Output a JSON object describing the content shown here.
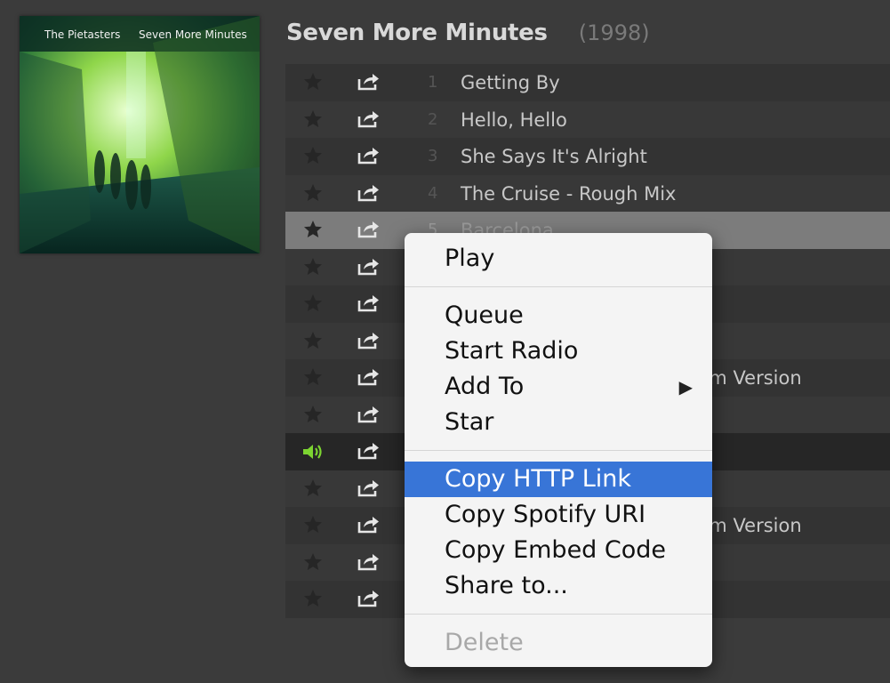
{
  "album": {
    "artist_cover_label": "The Pietasters",
    "cover_title_label": "Seven More Minutes",
    "title": "Seven More Minutes",
    "year": "(1998)"
  },
  "tracks": [
    {
      "num": "1",
      "name": "Getting By"
    },
    {
      "num": "2",
      "name": "Hello, Hello"
    },
    {
      "num": "3",
      "name": "She Says It's Alright"
    },
    {
      "num": "4",
      "name": "The Cruise - Rough Mix"
    },
    {
      "num": "5",
      "name": "Barcelona"
    },
    {
      "num": "",
      "name": ""
    },
    {
      "num": "",
      "name": ""
    },
    {
      "num": "",
      "name": ""
    },
    {
      "num": "",
      "name": "",
      "tail": "um Version"
    },
    {
      "num": "",
      "name": ""
    },
    {
      "num": "",
      "name": "",
      "playing": true
    },
    {
      "num": "",
      "name": ""
    },
    {
      "num": "",
      "name": "",
      "tail": "um Version"
    },
    {
      "num": "",
      "name": ""
    },
    {
      "num": "",
      "name": ""
    }
  ],
  "context_menu": {
    "play": "Play",
    "queue": "Queue",
    "start_radio": "Start Radio",
    "add_to": "Add To",
    "add_to_arrow": "▶",
    "star": "Star",
    "copy_http_link": "Copy HTTP Link",
    "copy_spotify_uri": "Copy Spotify URI",
    "copy_embed_code": "Copy Embed Code",
    "share_to": "Share to...",
    "delete": "Delete"
  },
  "colors": {
    "highlight": "#3875d7",
    "playing_icon": "#7cd431"
  }
}
